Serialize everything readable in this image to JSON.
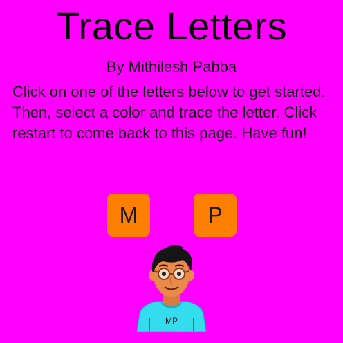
{
  "page": {
    "title": "Trace Letters",
    "byline": "By Mithilesh Pabba",
    "instructions": "Click on one of the letters below to get started. Then, select a color and trace the letter. Click restart to come back to this page. Have fun!"
  },
  "letters": [
    {
      "label": "M"
    },
    {
      "label": "P"
    }
  ],
  "avatar": {
    "shirt_text": "MP",
    "icon": "boy-with-glasses-avatar"
  },
  "colors": {
    "background": "#ff00ff",
    "button": "#ff8000",
    "shirt": "#33ddee",
    "skin": "#e88a4a"
  }
}
